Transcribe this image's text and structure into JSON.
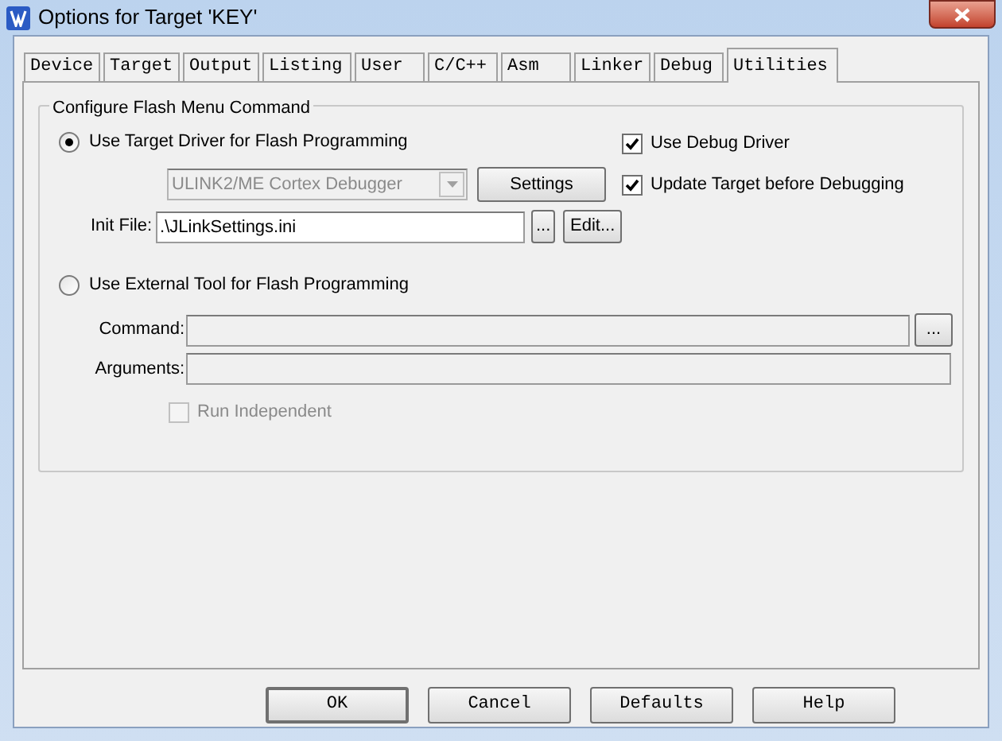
{
  "window": {
    "title": "Options for Target 'KEY'"
  },
  "tabs": [
    {
      "label": "Device",
      "selected": false
    },
    {
      "label": "Target",
      "selected": false
    },
    {
      "label": "Output",
      "selected": false
    },
    {
      "label": "Listing",
      "selected": false
    },
    {
      "label": "User",
      "selected": false
    },
    {
      "label": "C/C++",
      "selected": false
    },
    {
      "label": "Asm",
      "selected": false
    },
    {
      "label": "Linker",
      "selected": false
    },
    {
      "label": "Debug",
      "selected": false
    },
    {
      "label": "Utilities",
      "selected": true
    }
  ],
  "group": {
    "title": "Configure Flash Menu Command"
  },
  "target_driver": {
    "label": "Use Target Driver for Flash Programming",
    "selected": true,
    "driver": "ULINK2/ME Cortex Debugger",
    "driver_disabled": true,
    "settings_button": "Settings",
    "init_file_label": "Init File:",
    "init_file": ".\\JLinkSettings.ini",
    "browse_button": "...",
    "edit_button": "Edit..."
  },
  "checkboxes": [
    {
      "label": "Use Debug Driver",
      "checked": true
    },
    {
      "label": "Update Target before Debugging",
      "checked": true
    }
  ],
  "external_tool": {
    "label": "Use External Tool for Flash Programming",
    "selected": false,
    "command_label": "Command:",
    "browse_button": "...",
    "arguments_label": "Arguments:",
    "run_independent": {
      "label": "Run Independent",
      "checked": false,
      "disabled": true
    }
  },
  "buttons": [
    "OK",
    "Cancel",
    "Defaults",
    "Help"
  ]
}
